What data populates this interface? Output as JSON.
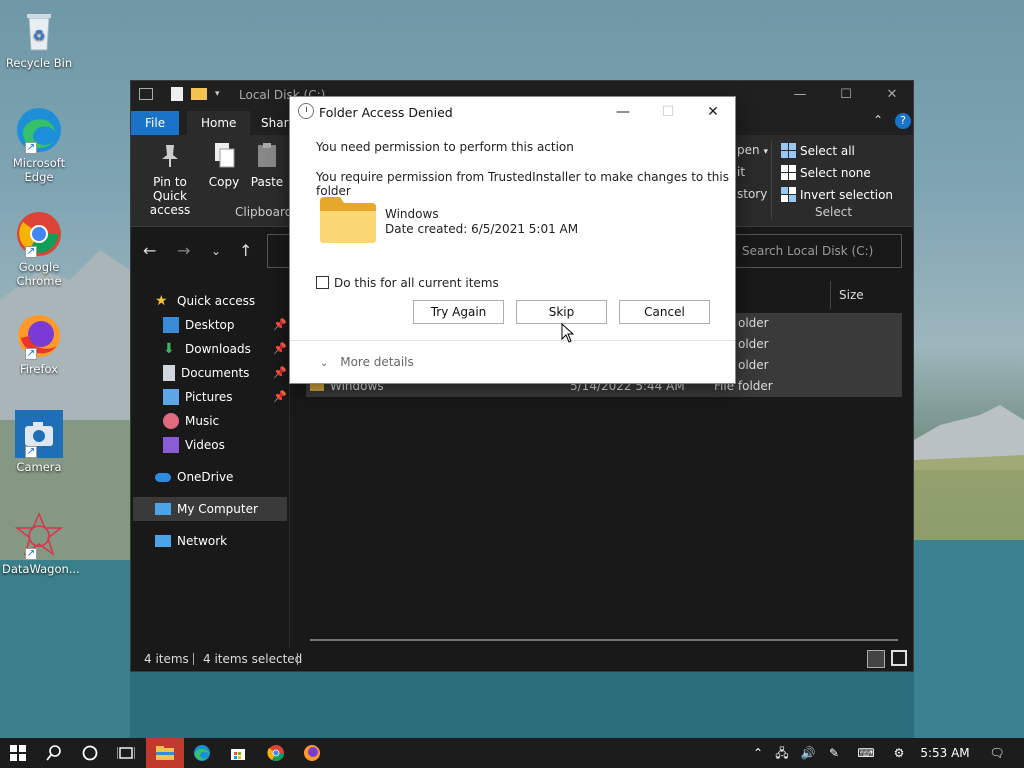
{
  "desktop": {
    "icons": [
      {
        "label": "Recycle Bin",
        "icon": "recycle-bin-icon"
      },
      {
        "label": "Microsoft Edge",
        "icon": "edge-icon"
      },
      {
        "label": "Google Chrome",
        "icon": "chrome-icon"
      },
      {
        "label": "Firefox",
        "icon": "firefox-icon"
      },
      {
        "label": "Camera",
        "icon": "camera-icon"
      },
      {
        "label": "DataWagon...",
        "icon": "datawagon-icon"
      }
    ]
  },
  "explorer": {
    "title": "Local Disk (C:)",
    "tabs": {
      "file": "File",
      "home": "Home",
      "share": "Share"
    },
    "ribbon": {
      "pin_label": "Pin to Quick access",
      "copy_label": "Copy",
      "paste_label": "Paste",
      "clipboard_group": "Clipboard",
      "open_partial": "pen",
      "edit_partial": "it",
      "history_partial": "story",
      "select_all": "Select all",
      "select_none": "Select none",
      "invert_selection": "Invert selection",
      "select_group": "Select"
    },
    "search_placeholder": "Search Local Disk (C:)",
    "column_size": "Size",
    "sidebar": {
      "quick_access": "Quick access",
      "items": [
        {
          "label": "Desktop"
        },
        {
          "label": "Downloads"
        },
        {
          "label": "Documents"
        },
        {
          "label": "Pictures"
        },
        {
          "label": "Music"
        },
        {
          "label": "Videos"
        }
      ],
      "onedrive": "OneDrive",
      "my_computer": "My Computer",
      "network": "Network"
    },
    "rows": [
      {
        "name": "",
        "date": "",
        "type": "older"
      },
      {
        "name": "",
        "date": "",
        "type": "older"
      },
      {
        "name": "",
        "date": "",
        "type": "older"
      },
      {
        "name": "Windows",
        "date": "5/14/2022 5:44 AM",
        "type": "File folder"
      }
    ],
    "status": {
      "items": "4 items",
      "selected": "4 items selected"
    }
  },
  "dialog": {
    "title": "Folder Access Denied",
    "line1": "You need permission to perform this action",
    "line2": "You require permission from TrustedInstaller to make changes to this folder",
    "folder_name": "Windows",
    "date_created": "Date created: 6/5/2021 5:01 AM",
    "checkbox_label": "Do this for all current items",
    "try_again": "Try Again",
    "skip": "Skip",
    "cancel": "Cancel",
    "more_details": "More details"
  },
  "taskbar": {
    "time": "5:53 AM"
  }
}
